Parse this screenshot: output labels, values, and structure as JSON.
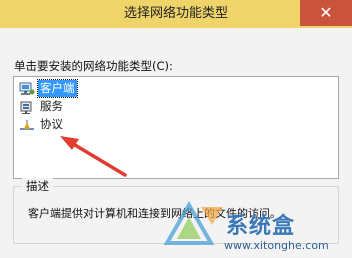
{
  "window": {
    "title": "选择网络功能类型",
    "close_glyph": "✕"
  },
  "prompt": "单击要安装的网络功能类型(C):",
  "list": {
    "items": [
      {
        "label": "客户端",
        "icon": "network-client-icon",
        "selected": true
      },
      {
        "label": "服务",
        "icon": "network-service-icon",
        "selected": false
      },
      {
        "label": "协议",
        "icon": "network-protocol-icon",
        "selected": false
      }
    ]
  },
  "description": {
    "group_label": "描述",
    "text": "客户端提供对计算机和连接到网络上的文件的访问。"
  },
  "watermark": {
    "text": "系统盒",
    "url": "www.xitonghe.com"
  },
  "colors": {
    "titlebar": "#efd46a",
    "close": "#c9533b",
    "selection": "#3399ff",
    "arrow": "#e23b2f"
  }
}
